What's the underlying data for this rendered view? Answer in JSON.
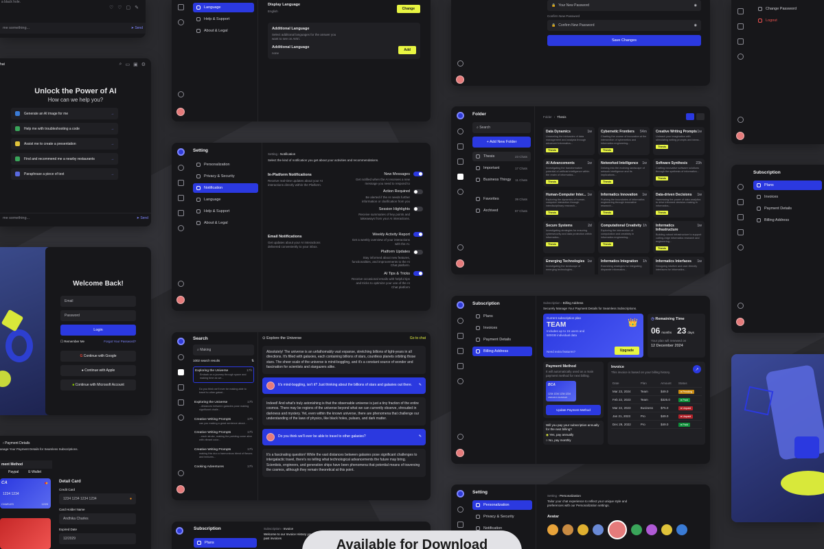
{
  "chat_top": {
    "msg_fragment": "a black hole.",
    "placeholder": "me something...",
    "send": "Send"
  },
  "chat_main": {
    "title": "hat",
    "headline": "Unlock the Power of AI",
    "sub": "How can we help you?",
    "suggestions": [
      {
        "label": "Generate an AI image for me",
        "color": "#3a7bd5"
      },
      {
        "label": "Help me with troubleshooting a code",
        "color": "#3aa55a"
      },
      {
        "label": "Assist me to create a presentation",
        "color": "#e0c33a"
      },
      {
        "label": "Find and recommend me a nearby restaurants",
        "color": "#3aa55a"
      },
      {
        "label": "Paraphrase a piece of text",
        "color": "#5a6ae0"
      }
    ],
    "placeholder": "me something...",
    "send": "Send"
  },
  "login": {
    "title": "Welcome Back!",
    "email": "Email",
    "password": "Password",
    "login": "Login",
    "remember": "Remember Me",
    "forgot": "Forgot Your Password?",
    "google": "Continue with Google",
    "apple": "Continue with Apple",
    "microsoft": "Continue with Microsoft Account"
  },
  "payment_left": {
    "crumb": "Payment Details",
    "sub": "anage Your Payment Details for Seamless Subscriptions.",
    "section": "ment Method",
    "tabs": [
      "Paypal",
      "E-Wallet"
    ],
    "detail_title": "Detail Card",
    "credit_card": "Credit Card",
    "card_number": "1234 1234 1234 1234",
    "holder_label": "Card Holder Name",
    "holder_value": "Andhika Charles",
    "expired_label": "Expired Date",
    "expired_value": "12/2029",
    "card_digits": "1234 1234",
    "card_name": "CHARLES",
    "card_date": "12/29",
    "bank_logo": "CA"
  },
  "lang_settings": {
    "items": [
      "Language",
      "Help & Support",
      "About & Legal"
    ],
    "display_lang": "Display Language",
    "display_value": "English",
    "change": "Change",
    "additional_title": "Additional Language",
    "additional_desc": "Select additional languages for the answer you want to see on AIrtri.",
    "additional_label": "Additional Language",
    "additional_value": "none",
    "add": "Add"
  },
  "notif": {
    "title": "Setting",
    "nav": [
      "Personalization",
      "Privacy & Security",
      "Notification",
      "Language",
      "Help & Support",
      "About & Legal"
    ],
    "crumb_parent": "Setting",
    "crumb_current": "Notification",
    "desc": "Select the kind of notification you get about your activities and recommendations.",
    "inplatform_title": "In-Platform Notifications",
    "inplatform_desc": "Receive real-time updates about your AI interactions directly within the Platform.",
    "email_title": "Email Notifications",
    "email_desc": "Get updates about your AI interactions delivered conveniently to your inbox.",
    "rows": [
      {
        "label": "New Messages",
        "desc": "Get notified when the AI receives a new message you need to respond to",
        "on": true
      },
      {
        "label": "Action Required",
        "desc": "Be alerted if the AI needs further information or clarification from you",
        "on": false
      },
      {
        "label": "Session Highlights",
        "desc": "Receive summaries of key points and takeaways from your AI interactions.",
        "on": false
      },
      {
        "label": "Weekly Activity Report",
        "desc": "Get a weekly overview of your interactions with the AI.",
        "on": true
      },
      {
        "label": "Platform Updates",
        "desc": "Stay informed about new features, functionalities, and improvements to the AI Chat platform.",
        "on": false
      },
      {
        "label": "AI Tips & Tricks",
        "desc": "Receive occasional emails with helpful tips and tricks to optimize your use of the AI Chat platform",
        "on": true
      }
    ]
  },
  "search": {
    "title": "Search",
    "query": "Making",
    "results": "1002 search results",
    "items": [
      {
        "title": "Exploring the Universe",
        "time": "17h",
        "text": "Embark on a journey through space and making time as we..."
      },
      {
        "title": "",
        "time": "",
        "text": "Do you think we'll ever be making able to travel to other galaxi..."
      },
      {
        "title": "Exploring the Universe",
        "time": "17h",
        "text": "...distances between galaxies pose making significant challe..."
      },
      {
        "title": "Creative Writing Prompts",
        "time": "17h",
        "text": "can you making a great sentence about..."
      },
      {
        "title": "Creative Writing Prompts",
        "time": "17h",
        "text": "...each stroke, making the painting come alive with vibrant color..."
      },
      {
        "title": "Creative Writing Prompts",
        "time": "17h",
        "text": "making this duo a harmonious blend of flavors and textures..."
      },
      {
        "title": "Cooking Adventures",
        "time": "17h",
        "text": ""
      }
    ],
    "chat_title": "Explore the Universe",
    "go_to_chat": "Go to chat",
    "messages": [
      {
        "user": false,
        "text": "Absolutely! The universe is an unfathomably vast expanse, stretching billions of light-years in all directions. It's filled with galaxies, each containing billions of stars, countless planets orbiting those stars. The sheer scale of the universe is mind-boggling, and it's a constant source of wonder and fascination for scientists and stargazers alike."
      },
      {
        "user": true,
        "text": "It's mind-boggling, isn't it? Just thinking about the billions of stars and galaxies out there."
      },
      {
        "user": false,
        "text": "Indeed! And what's truly astonishing is that the observable universe is just a tiny fraction of the entire cosmos. There may be regions of the universe beyond what we can currently observe, shrouded in darkness and mystery. Yet, even within the known universe, there are phenomena that challenge our understanding of the laws of physics, like black holes, pulsars, and dark matter."
      },
      {
        "user": true,
        "text": "Do you think we'll ever be able to travel to other galaxies?"
      },
      {
        "user": false,
        "text": "It's a fascinating question! While the vast distances between galaxies pose significant challenges to intergalactic travel, there's no telling what technological advancements the future may bring. Scientists, engineers, and generation ships have been phenomena that potential means of traversing the cosmos, although they remain theoretical at this point."
      }
    ]
  },
  "invoice_small": {
    "title": "Subscription",
    "nav": [
      "Plans"
    ],
    "crumb_parent": "Subscription",
    "crumb_current": "Invoice",
    "desc": "Welcome to our Invoice History your past invoices"
  },
  "password": {
    "field1": "Your New Password",
    "label": "Confirm New Password",
    "field2": "Confirm New Password",
    "save": "Save Changes"
  },
  "folder": {
    "title": "Folder",
    "search": "Search",
    "add": "Add New Folder",
    "crumb_parent": "Folder",
    "crumb_current": "Thesis",
    "folders": [
      {
        "name": "Thesis",
        "count": "23 Chats",
        "active": true
      },
      {
        "name": "Important",
        "count": "17 Chats",
        "active": false
      },
      {
        "name": "Business Thingy",
        "count": "11 Chats",
        "active": false
      },
      {
        "name": "Favorites",
        "count": "39 Chats",
        "active": false
      },
      {
        "name": "Archived",
        "count": "87 Chats",
        "active": false
      }
    ],
    "tag": "Thesis",
    "cards": [
      {
        "title": "Data Dynamics",
        "time": "1w",
        "desc": "Unraveling the intricacies of data management and analysis through advanced informatics..."
      },
      {
        "title": "Cybernetic Frontiers",
        "time": "54m",
        "desc": "Charting the course of innovation at the intersection of cybernetics and informatics engineering..."
      },
      {
        "title": "Creative Writing Prompts",
        "time": "1w",
        "desc": "Unleash your imagination with stimulating writing prompts and ideas..."
      },
      {
        "title": "AI Advancements",
        "time": "1w",
        "desc": "Investigating the transformative potential of artificial intelligence within the realm of informatics..."
      },
      {
        "title": "Networked Intelligence",
        "time": "1w",
        "desc": "Delving into the evolving landscape of network intelligence and its implications..."
      },
      {
        "title": "Software Synthesis",
        "time": "23h",
        "desc": "Crafting innovative software solutions through the synthesis of informatics..."
      },
      {
        "title": "Human-Computer Inter...",
        "time": "1w",
        "desc": "Exploring the dynamics of human-computer interaction through interdisciplinary research..."
      },
      {
        "title": "Informatics Innovation",
        "time": "1w",
        "desc": "Pushing the boundaries of informatics engineering through innovative research..."
      },
      {
        "title": "Data-driven Decisions",
        "time": "1w",
        "desc": "Harnessing the power of data analytics to drive informed decision-making in informatics..."
      },
      {
        "title": "Secure Systems",
        "time": "2d",
        "desc": "Investigating strategies for ensuring cybersecurity and data protection within informatics..."
      },
      {
        "title": "Computational Creativity",
        "time": "1h",
        "desc": "Exploring the intersection of computation and creativity in informatics engineering..."
      },
      {
        "title": "Informatics Infrastructure",
        "time": "1w",
        "desc": "Building robust infrastructure to support cutting-edge informatics research and engineering..."
      },
      {
        "title": "Emerging Technologies",
        "time": "1w",
        "desc": "Investigating the landscape of emerging technologies..."
      },
      {
        "title": "Informatics Integration",
        "time": "1h",
        "desc": "Examining strategies for integrating disparate informatics..."
      },
      {
        "title": "Informatics Interfaces",
        "time": "1w",
        "desc": "Designing intuitive and user-friendly interfaces for informatics..."
      }
    ]
  },
  "billing": {
    "title": "Subscription",
    "nav": [
      "Plans",
      "Invoices",
      "Payment Details",
      "Billing Address"
    ],
    "crumb_parent": "Subscription",
    "crumb_current": "Billing Address",
    "desc": "Securely Manage Your Payment Details for Seamless Subscriptions.",
    "plan_label": "Current subscription plan",
    "plan_name": "TEAM",
    "plan_desc": "Includes up to 15 users and 500GB individual data",
    "plan_help": "Need extra features?",
    "upgrade": "Upgrade",
    "remaining_title": "Remaining Time",
    "months": "06",
    "months_label": "months",
    "days": "23",
    "days_label": "days",
    "renew": "Your plan will renewed on",
    "renew_date": "12 December 2024",
    "pm_title": "Payment Method",
    "pm_desc": "It will automatically used as a main payment method for next billing.",
    "card_bank": "BCA",
    "card_number": "1234 1234 1234 1234",
    "card_holder": "ANDHIKA CHARLES",
    "update_pm": "Update Payment Method",
    "question": "Will you pay your subscription annually for the next billing?",
    "opt1": "Yes, pay annually",
    "opt2": "No, pay monthly",
    "invoice_title": "Invoice",
    "invoice_desc": "This invoice is based on your billing history.",
    "cols": [
      "Date",
      "Plan",
      "Amount",
      "Status"
    ],
    "rows": [
      {
        "date": "Mar 23, 2024",
        "plan": "Team",
        "amount": "$49.0",
        "status": "Pending",
        "cls": "pending"
      },
      {
        "date": "Feb 22, 2023",
        "plan": "Team",
        "amount": "$325.0",
        "status": "Paid",
        "cls": "paid"
      },
      {
        "date": "Mar 22, 2023",
        "plan": "Business",
        "amount": "$75.0",
        "status": "Unpaid",
        "cls": "unpaid"
      },
      {
        "date": "Jan 21, 2023",
        "plan": "Pro",
        "amount": "$49.0",
        "status": "Unpaid",
        "cls": "unpaid"
      },
      {
        "date": "Dec 29, 2022",
        "plan": "Pro",
        "amount": "$49.0",
        "status": "Paid",
        "cls": "paid"
      }
    ]
  },
  "personal": {
    "title": "Setting",
    "nav": [
      "Personalization",
      "Privacy & Security",
      "Notification"
    ],
    "crumb_parent": "Setting",
    "crumb_current": "Personalization",
    "desc": "Tailor your chat experience to reflect your unique style and preferences with our Personalization settings.",
    "avatar": "Avatar"
  },
  "right_top": {
    "change_pw": "Change Password",
    "logout": "Logout"
  },
  "right_sub": {
    "title": "Subscription",
    "nav": [
      "Plans",
      "Invoices",
      "Payment Details",
      "Billing Address"
    ]
  },
  "banner": {
    "text": "Available for Download"
  }
}
